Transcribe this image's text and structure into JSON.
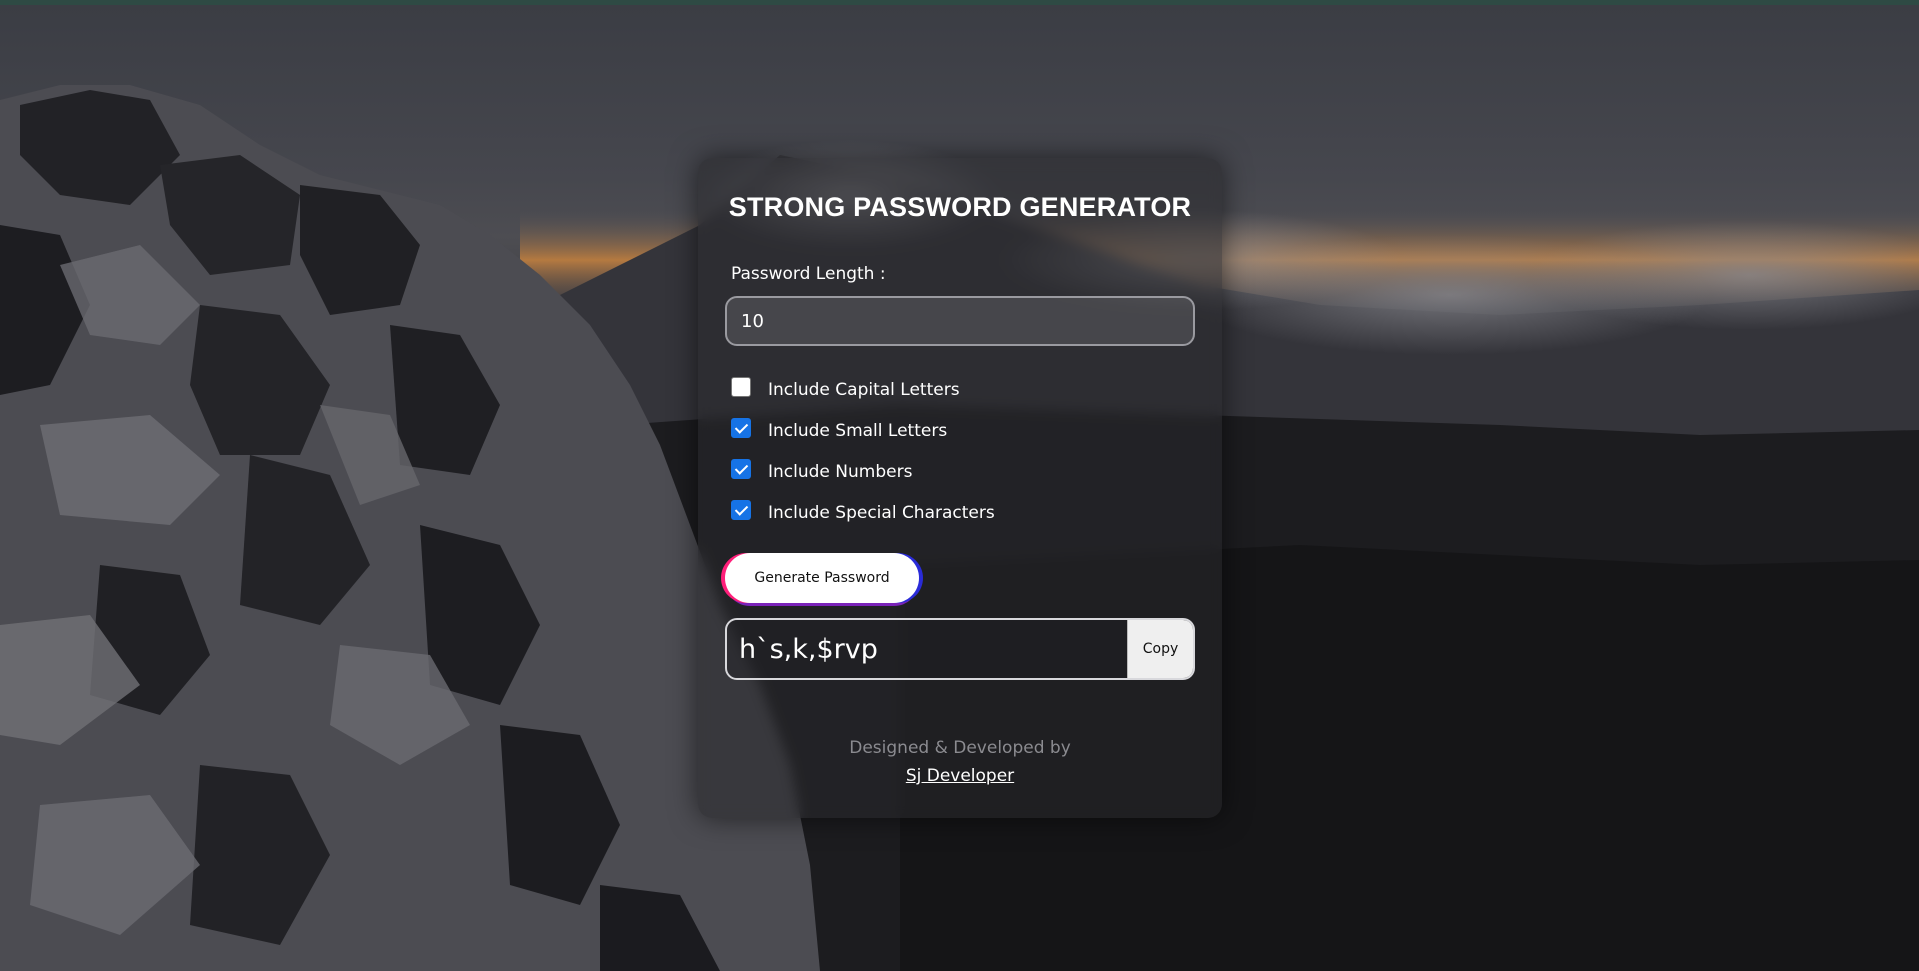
{
  "app": {
    "title": "STRONG PASSWORD GENERATOR"
  },
  "length": {
    "label": "Password Length :",
    "value": "10"
  },
  "options": [
    {
      "label": "Include Capital Letters",
      "checked": false
    },
    {
      "label": "Include Small Letters",
      "checked": true
    },
    {
      "label": "Include Numbers",
      "checked": true
    },
    {
      "label": "Include Special Characters",
      "checked": true
    }
  ],
  "generate": {
    "label": "Generate Password"
  },
  "result": {
    "password": "h`s,k,$rvp",
    "copy_label": "Copy"
  },
  "footer": {
    "credit": "Designed & Developed by",
    "author": "Sj Developer"
  },
  "colors": {
    "checkbox_accent": "#1673e6",
    "button_gradient_left": "#ff1f7a",
    "button_gradient_right": "#2a2bd8",
    "top_bar": "#2e4a44"
  }
}
